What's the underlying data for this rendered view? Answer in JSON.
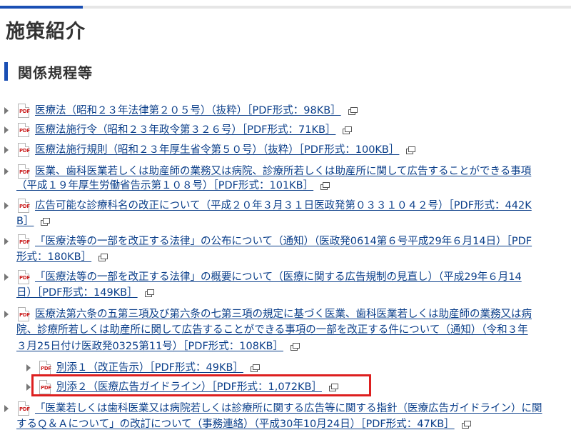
{
  "page": {
    "title": "施策紹介"
  },
  "section": {
    "heading": "関係規程等"
  },
  "items": [
    {
      "lines": [
        "医療法（昭和２３年法律第２０５号）（抜粋）［PDF形式：98KB］"
      ]
    },
    {
      "lines": [
        "医療法施行令（昭和２３年政令第３２６号）［PDF形式：71KB］"
      ]
    },
    {
      "lines": [
        "医療法施行規則（昭和２３年厚生省令第５０号）（抜粋）［PDF形式：100KB］"
      ]
    },
    {
      "lines": [
        "医業、歯科医業若しくは助産師の業務又は病院、診療所若しくは助産所に関して広告することができる事項",
        "（平成１９年厚生労働省告示第１０８号）［PDF形式：101KB］"
      ]
    },
    {
      "lines": [
        "広告可能な診療科名の改正について（平成２０年３月３１日医政発第０３３１０４２号）［PDF形式：442K",
        "B］"
      ]
    },
    {
      "lines": [
        "「医療法等の一部を改正する法律」の公布について（通知）（医政発0614第６号平成29年６月14日）［PDF",
        "形式：180KB］"
      ]
    },
    {
      "lines": [
        "「医療法等の一部を改正する法律」の概要について（医療に関する広告規制の見直し）（平成29年６月14",
        "日）［PDF形式：149KB］"
      ]
    },
    {
      "lines": [
        "医療法第六条の五第三項及び第六条の七第三項の規定に基づく医業、歯科医業若しくは助産師の業務又は病",
        "院、診療所若しくは助産所に関して広告することができる事項の一部を改正する件について（通知）（令和３年",
        "３月25日付け医政発0325第11号）［PDF形式：108KB］"
      ]
    },
    {
      "lines": [
        "別添１（改正告示）［PDF形式：49KB］"
      ]
    },
    {
      "lines": [
        "別添２（医療広告ガイドライン）［PDF形式：1,072KB］"
      ]
    },
    {
      "lines": [
        "「医業若しくは歯科医業又は病院若しくは診療所に関する広告等に関する指針（医療広告ガイドライン）に関",
        "するＱ＆Ａについて」の改訂について（事務連絡）（平成30年10月24日）［PDF形式：47KB］"
      ]
    }
  ],
  "icons": {
    "file": "pdf-file-icon",
    "external": "new-window-icon",
    "bullet": "triangle-bullet-icon"
  },
  "icon_text": {
    "pdf": "PDF"
  },
  "colors": {
    "accent": "#1a4fb4",
    "link": "#0b3f8a",
    "highlight": "#dd1f1f",
    "pdf_red": "#cc2222"
  }
}
